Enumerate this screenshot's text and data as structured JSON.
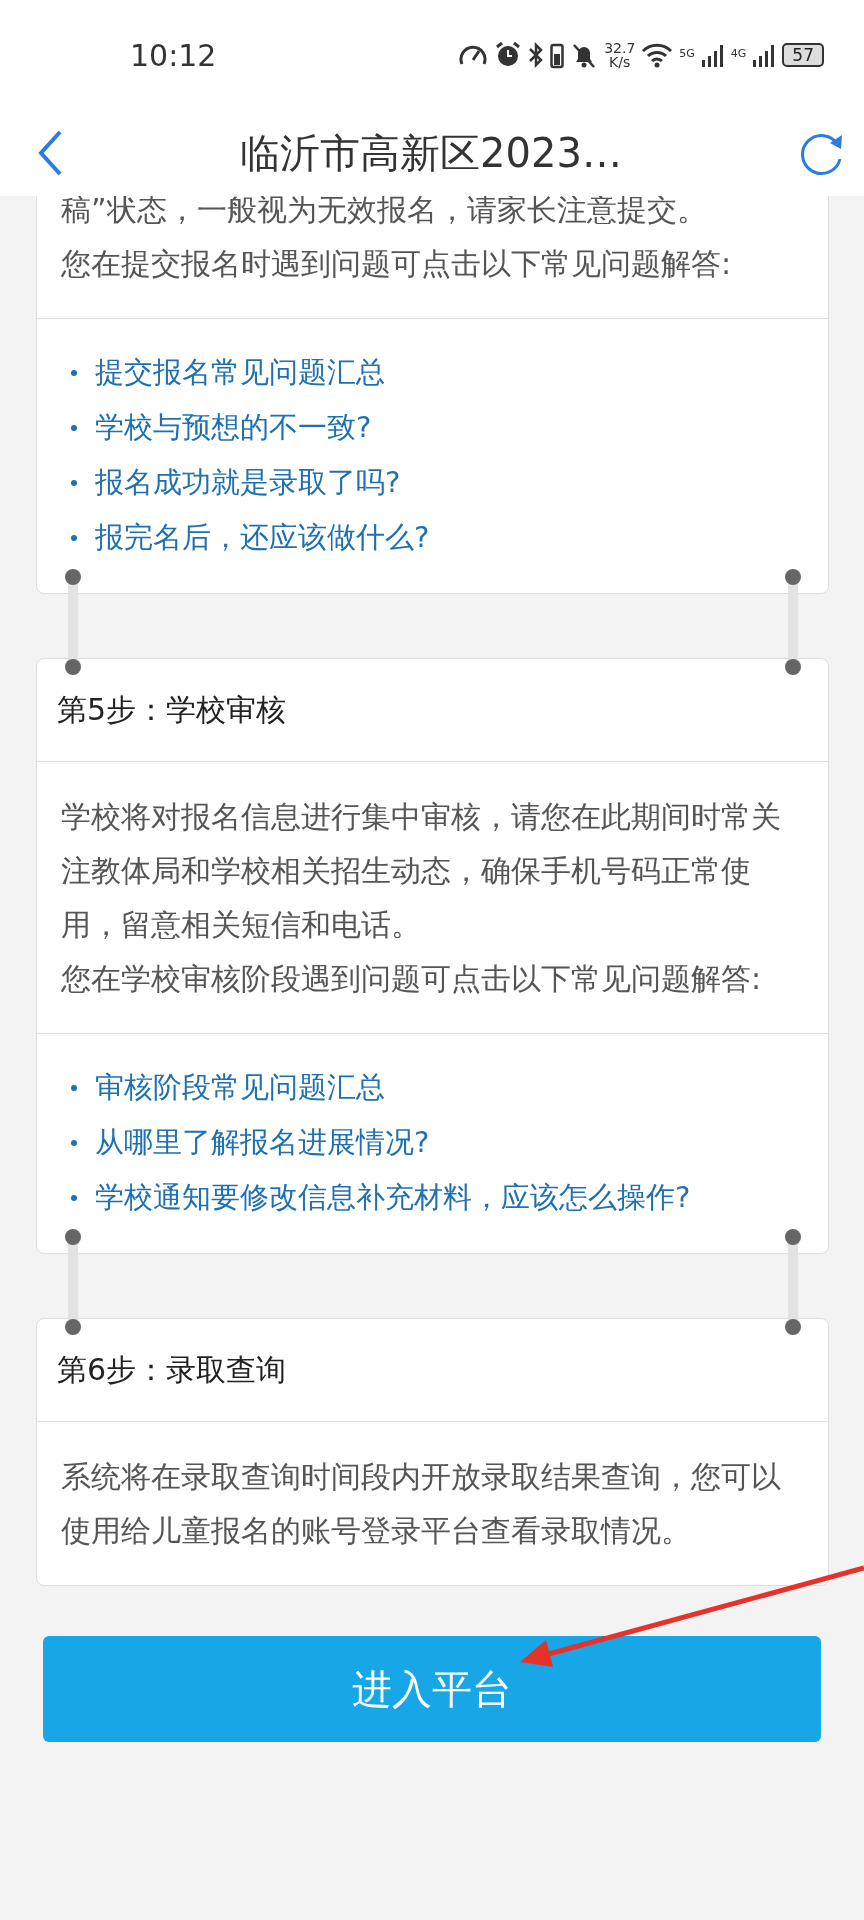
{
  "status_bar": {
    "time": "10:12",
    "net_speed": "32.7",
    "net_speed_unit": "K/s",
    "network_1": "5G",
    "network_2": "4G",
    "battery": "57"
  },
  "header": {
    "title": "临沂市高新区2023…"
  },
  "steps": [
    {
      "body": [
        "稿”状态，一般视为无效报名，请家长注意提交。",
        "您在提交报名时遇到问题可点击以下常见问题解答:"
      ],
      "links": [
        "提交报名常见问题汇总",
        "学校与预想的不一致?",
        "报名成功就是录取了吗?",
        "报完名后，还应该做什么?"
      ]
    },
    {
      "title": "第5步：学校审核",
      "body": [
        "学校将对报名信息进行集中审核，请您在此期间时常关注教体局和学校相关招生动态，确保手机号码正常使用，留意相关短信和电话。",
        "您在学校审核阶段遇到问题可点击以下常见问题解答:"
      ],
      "links": [
        "审核阶段常见问题汇总",
        "从哪里了解报名进展情况?",
        "学校通知要修改信息补充材料，应该怎么操作?"
      ]
    },
    {
      "title": "第6步：录取查询",
      "body": [
        "系统将在录取查询时间段内开放录取结果查询，您可以使用给儿童报名的账号登录平台查看录取情况。"
      ]
    }
  ],
  "button": {
    "label": "进入平台"
  }
}
